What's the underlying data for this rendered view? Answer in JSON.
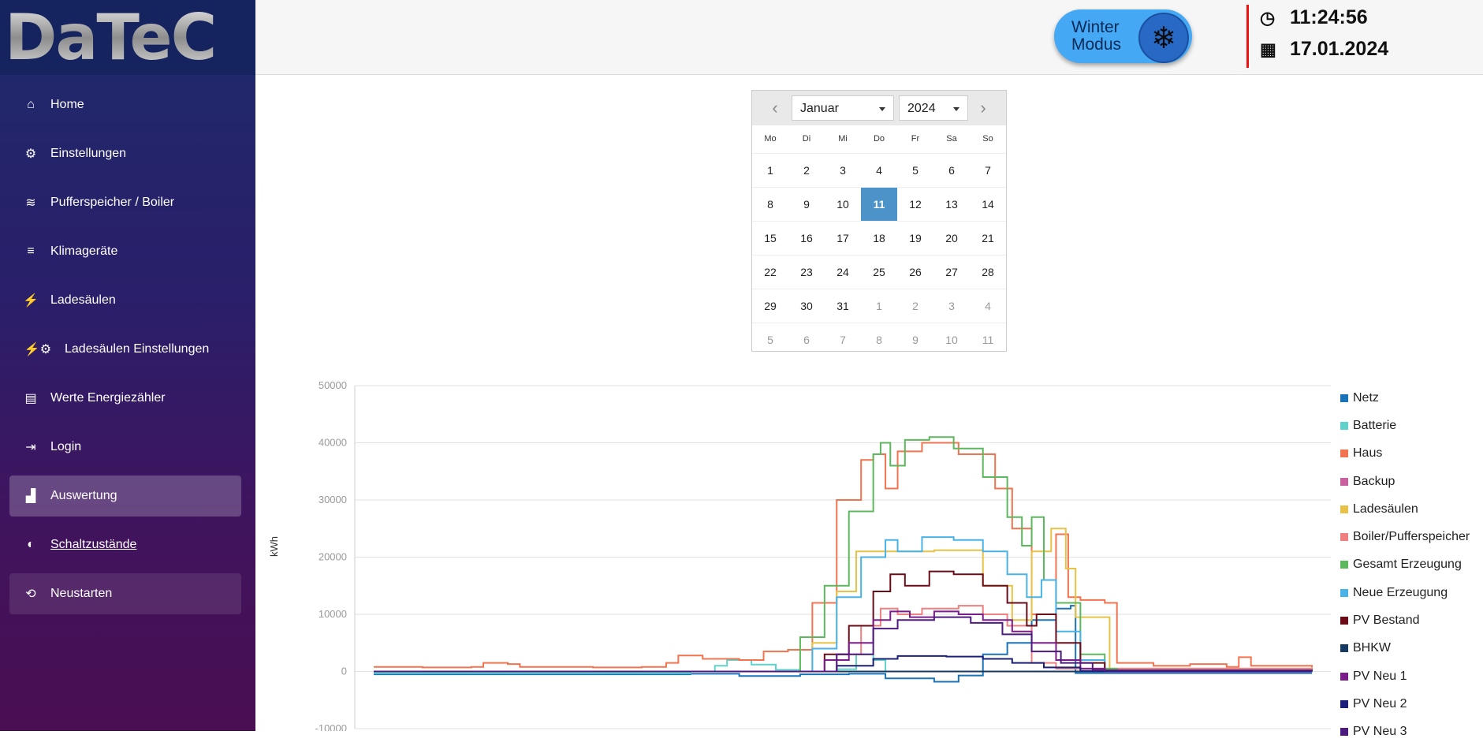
{
  "app": {
    "logo_text": "DaTeC"
  },
  "sidebar": {
    "items": [
      {
        "label": "Home",
        "icon": "home-icon",
        "glyph": "⌂"
      },
      {
        "label": "Einstellungen",
        "icon": "gear-icon",
        "glyph": "⚙"
      },
      {
        "label": "Pufferspeicher / Boiler",
        "icon": "water-icon",
        "glyph": "≋"
      },
      {
        "label": "Klimageräte",
        "icon": "fan-icon",
        "glyph": "≡"
      },
      {
        "label": "Ladesäulen",
        "icon": "charging-station-icon",
        "glyph": "⚡"
      },
      {
        "label": "Ladesäulen Einstellungen",
        "icon": "charging-station-gear-icon",
        "glyph": "⚡⚙"
      },
      {
        "label": "Werte Energiezähler",
        "icon": "meter-icon",
        "glyph": "▤"
      },
      {
        "label": "Login",
        "icon": "login-icon",
        "glyph": "⇥"
      },
      {
        "label": "Auswertung",
        "icon": "chart-area-icon",
        "glyph": "▟"
      },
      {
        "label": "Schaltzustände",
        "icon": "toggle-icon",
        "glyph": "◐"
      },
      {
        "label": "Neustarten",
        "icon": "restart-icon",
        "glyph": "⟲"
      }
    ]
  },
  "header": {
    "winter_mode_label": "Winter Modus",
    "snowflake_glyph": "❄",
    "time": "11:24:56",
    "date": "17.01.2024",
    "clock_glyph": "◷",
    "calendar_glyph": "▦"
  },
  "calendar": {
    "month": "Januar",
    "year": "2024",
    "prev_glyph": "‹",
    "next_glyph": "›",
    "weekdays": [
      "Mo",
      "Di",
      "Mi",
      "Do",
      "Fr",
      "Sa",
      "So"
    ],
    "selected_day": "11",
    "weeks": [
      [
        "1",
        "2",
        "3",
        "4",
        "5",
        "6",
        "7"
      ],
      [
        "8",
        "9",
        "10",
        "11",
        "12",
        "13",
        "14"
      ],
      [
        "15",
        "16",
        "17",
        "18",
        "19",
        "20",
        "21"
      ],
      [
        "22",
        "23",
        "24",
        "25",
        "26",
        "27",
        "28"
      ],
      [
        "29",
        "30",
        "31",
        "1",
        "2",
        "3",
        "4"
      ],
      [
        "5",
        "6",
        "7",
        "8",
        "9",
        "10",
        "11"
      ]
    ],
    "muted_from_index": 31
  },
  "chart_data": {
    "type": "line",
    "ylabel": "kWh",
    "ylim": [
      -10000,
      50000
    ],
    "yticks": [
      50000,
      40000,
      30000,
      20000,
      10000,
      0,
      -10000
    ],
    "grid": true,
    "legend_position": "right",
    "series": [
      {
        "name": "Netz",
        "color": "#1a73b8",
        "points": [
          [
            0,
            -500
          ],
          [
            100,
            -500
          ],
          [
            130,
            -400
          ],
          [
            150,
            -800
          ],
          [
            175,
            -500
          ],
          [
            195,
            -400
          ],
          [
            210,
            -1200
          ],
          [
            230,
            -1800
          ],
          [
            240,
            -700
          ],
          [
            250,
            3000
          ],
          [
            260,
            5000
          ],
          [
            270,
            9000
          ],
          [
            280,
            11000
          ],
          [
            286,
            11500
          ],
          [
            288,
            -300
          ],
          [
            385,
            -300
          ]
        ]
      },
      {
        "name": "Batterie",
        "color": "#5fd3c9",
        "points": [
          [
            0,
            -300
          ],
          [
            96,
            -300
          ],
          [
            97,
            -300
          ],
          [
            100,
            -300
          ],
          [
            120,
            -300
          ],
          [
            130,
            0
          ],
          [
            140,
            1000
          ],
          [
            145,
            2000
          ],
          [
            155,
            1200
          ],
          [
            165,
            300
          ],
          [
            175,
            0
          ],
          [
            190,
            400
          ],
          [
            198,
            3000
          ],
          [
            205,
            2000
          ],
          [
            210,
            0
          ],
          [
            385,
            -200
          ]
        ]
      },
      {
        "name": "Haus",
        "color": "#f2734f",
        "points": [
          [
            0,
            800
          ],
          [
            20,
            700
          ],
          [
            40,
            800
          ],
          [
            45,
            1500
          ],
          [
            55,
            1300
          ],
          [
            60,
            800
          ],
          [
            90,
            700
          ],
          [
            110,
            800
          ],
          [
            120,
            1500
          ],
          [
            125,
            2800
          ],
          [
            135,
            2200
          ],
          [
            150,
            2000
          ],
          [
            160,
            3500
          ],
          [
            170,
            3800
          ],
          [
            180,
            12000
          ],
          [
            190,
            30000
          ],
          [
            200,
            37000
          ],
          [
            205,
            38000
          ],
          [
            210,
            32000
          ],
          [
            215,
            38500
          ],
          [
            225,
            40000
          ],
          [
            240,
            38000
          ],
          [
            255,
            32000
          ],
          [
            262,
            25000
          ],
          [
            270,
            10000
          ],
          [
            280,
            24000
          ],
          [
            285,
            13000
          ],
          [
            290,
            12500
          ],
          [
            300,
            12000
          ],
          [
            305,
            1500
          ],
          [
            320,
            1000
          ],
          [
            335,
            1300
          ],
          [
            350,
            800
          ],
          [
            355,
            2500
          ],
          [
            360,
            1000
          ],
          [
            385,
            700
          ]
        ]
      },
      {
        "name": "Backup",
        "color": "#c8619e",
        "points": [
          [
            0,
            0
          ],
          [
            385,
            0
          ]
        ]
      },
      {
        "name": "Ladesäulen",
        "color": "#e8c246",
        "points": [
          [
            0,
            0
          ],
          [
            170,
            0
          ],
          [
            180,
            5000
          ],
          [
            190,
            14000
          ],
          [
            198,
            21000
          ],
          [
            210,
            21000
          ],
          [
            230,
            21200
          ],
          [
            240,
            21200
          ],
          [
            250,
            15000
          ],
          [
            262,
            9000
          ],
          [
            270,
            21000
          ],
          [
            278,
            25000
          ],
          [
            284,
            18000
          ],
          [
            288,
            9500
          ],
          [
            300,
            9500
          ],
          [
            302,
            500
          ],
          [
            385,
            0
          ]
        ]
      },
      {
        "name": "Boiler/Pufferspeicher",
        "color": "#f08080",
        "points": [
          [
            0,
            0
          ],
          [
            175,
            0
          ],
          [
            190,
            3000
          ],
          [
            200,
            8000
          ],
          [
            208,
            11000
          ],
          [
            215,
            10000
          ],
          [
            225,
            11000
          ],
          [
            240,
            11500
          ],
          [
            250,
            10000
          ],
          [
            260,
            8000
          ],
          [
            270,
            1500
          ],
          [
            280,
            500
          ],
          [
            385,
            0
          ]
        ]
      },
      {
        "name": "Gesamt Erzeugung",
        "color": "#5cb85c",
        "points": [
          [
            0,
            0
          ],
          [
            165,
            0
          ],
          [
            175,
            6000
          ],
          [
            185,
            15000
          ],
          [
            195,
            28000
          ],
          [
            205,
            38000
          ],
          [
            208,
            40000
          ],
          [
            212,
            36000
          ],
          [
            218,
            40500
          ],
          [
            228,
            41000
          ],
          [
            238,
            39000
          ],
          [
            250,
            34000
          ],
          [
            260,
            27000
          ],
          [
            266,
            22000
          ],
          [
            270,
            27000
          ],
          [
            275,
            16000
          ],
          [
            280,
            12000
          ],
          [
            290,
            3000
          ],
          [
            300,
            500
          ],
          [
            305,
            0
          ],
          [
            385,
            0
          ]
        ]
      },
      {
        "name": "Neue Erzeugung",
        "color": "#49b2e6",
        "points": [
          [
            0,
            0
          ],
          [
            170,
            0
          ],
          [
            180,
            4000
          ],
          [
            190,
            13000
          ],
          [
            200,
            20000
          ],
          [
            210,
            23000
          ],
          [
            215,
            21000
          ],
          [
            225,
            23500
          ],
          [
            238,
            23000
          ],
          [
            250,
            21000
          ],
          [
            260,
            17000
          ],
          [
            268,
            13000
          ],
          [
            274,
            16000
          ],
          [
            280,
            7000
          ],
          [
            290,
            2000
          ],
          [
            300,
            0
          ],
          [
            385,
            0
          ]
        ]
      },
      {
        "name": "PV Bestand",
        "color": "#6b0b18",
        "points": [
          [
            0,
            0
          ],
          [
            175,
            0
          ],
          [
            185,
            3000
          ],
          [
            195,
            8000
          ],
          [
            205,
            14000
          ],
          [
            212,
            17000
          ],
          [
            218,
            15000
          ],
          [
            228,
            17500
          ],
          [
            238,
            17000
          ],
          [
            250,
            15000
          ],
          [
            260,
            12000
          ],
          [
            268,
            8000
          ],
          [
            272,
            10000
          ],
          [
            280,
            5000
          ],
          [
            290,
            1500
          ],
          [
            300,
            0
          ],
          [
            385,
            0
          ]
        ]
      },
      {
        "name": "BHKW",
        "color": "#173a63",
        "points": [
          [
            0,
            0
          ],
          [
            385,
            0
          ]
        ]
      },
      {
        "name": "PV Neu 1",
        "color": "#7a1c8a",
        "points": [
          [
            0,
            0
          ],
          [
            175,
            0
          ],
          [
            185,
            2000
          ],
          [
            195,
            5000
          ],
          [
            205,
            9000
          ],
          [
            212,
            10500
          ],
          [
            220,
            9500
          ],
          [
            230,
            10500
          ],
          [
            240,
            10000
          ],
          [
            250,
            9000
          ],
          [
            262,
            7000
          ],
          [
            270,
            5000
          ],
          [
            280,
            2000
          ],
          [
            290,
            500
          ],
          [
            300,
            0
          ],
          [
            385,
            0
          ]
        ]
      },
      {
        "name": "PV Neu 2",
        "color": "#1b1f7a",
        "points": [
          [
            0,
            0
          ],
          [
            175,
            0
          ],
          [
            190,
            1000
          ],
          [
            205,
            2200
          ],
          [
            215,
            2700
          ],
          [
            235,
            2600
          ],
          [
            250,
            2200
          ],
          [
            262,
            1500
          ],
          [
            275,
            700
          ],
          [
            290,
            100
          ],
          [
            385,
            0
          ]
        ]
      },
      {
        "name": "PV Neu 3",
        "color": "#4d1a80",
        "points": [
          [
            0,
            0
          ],
          [
            178,
            0
          ],
          [
            190,
            3000
          ],
          [
            205,
            7500
          ],
          [
            215,
            9000
          ],
          [
            230,
            9500
          ],
          [
            245,
            8500
          ],
          [
            258,
            6500
          ],
          [
            270,
            3500
          ],
          [
            282,
            1500
          ],
          [
            295,
            200
          ],
          [
            385,
            0
          ]
        ]
      }
    ]
  }
}
